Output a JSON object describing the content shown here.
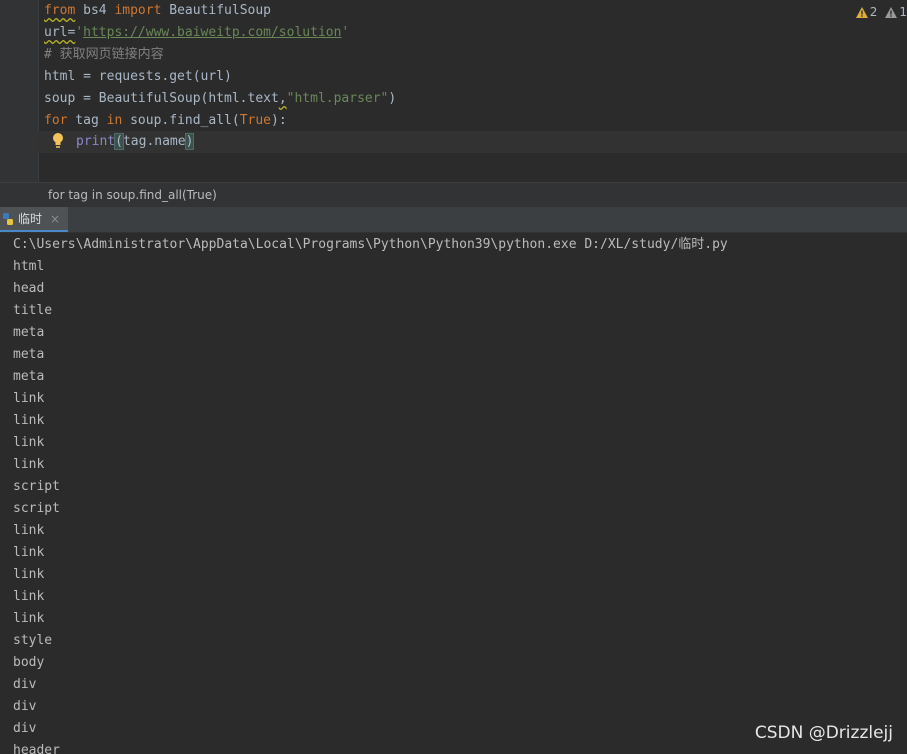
{
  "editor": {
    "lines": [
      {
        "kw1": "from",
        "t1": " bs4 ",
        "kw2": "import",
        "t2": " BeautifulSoup"
      },
      {
        "t1": "url=",
        "s1": "'",
        "link": "https://www.baiweitp.com/solution",
        "s2": "'"
      },
      {
        "comment": "# 获取网页链接内容"
      },
      {
        "t1": "html = requests.get(url)"
      },
      {
        "t1": "soup = BeautifulSoup(html.text",
        "t2": ",",
        "s1": "\"html.parser\"",
        "t3": ")"
      },
      {
        "kw1": "for",
        "t1": " tag ",
        "kw2": "in",
        "t2": " soup.find_all(",
        "kw3": "True",
        "t3": "):"
      },
      {
        "b1": "print",
        "p1": "(",
        "t1": "tag.name",
        "p2": ")"
      }
    ],
    "warnings": [
      {
        "icon": "warning-icon",
        "count": "2",
        "color": "#e0ac3c"
      },
      {
        "icon": "weak-warning-icon",
        "count": "1",
        "color": "#9a9a9a"
      }
    ]
  },
  "breadcrumb": {
    "text": "for tag in soup.find_all(True)"
  },
  "run_tab": {
    "label": "临时",
    "close": "×",
    "icon": "python-icon"
  },
  "console": {
    "command": "C:\\Users\\Administrator\\AppData\\Local\\Programs\\Python\\Python39\\python.exe D:/XL/study/临时.py",
    "output": [
      "html",
      "head",
      "title",
      "meta",
      "meta",
      "meta",
      "link",
      "link",
      "link",
      "link",
      "script",
      "script",
      "link",
      "link",
      "link",
      "link",
      "link",
      "style",
      "body",
      "div",
      "div",
      "div",
      "header"
    ]
  },
  "watermark": "CSDN @Drizzlejj"
}
